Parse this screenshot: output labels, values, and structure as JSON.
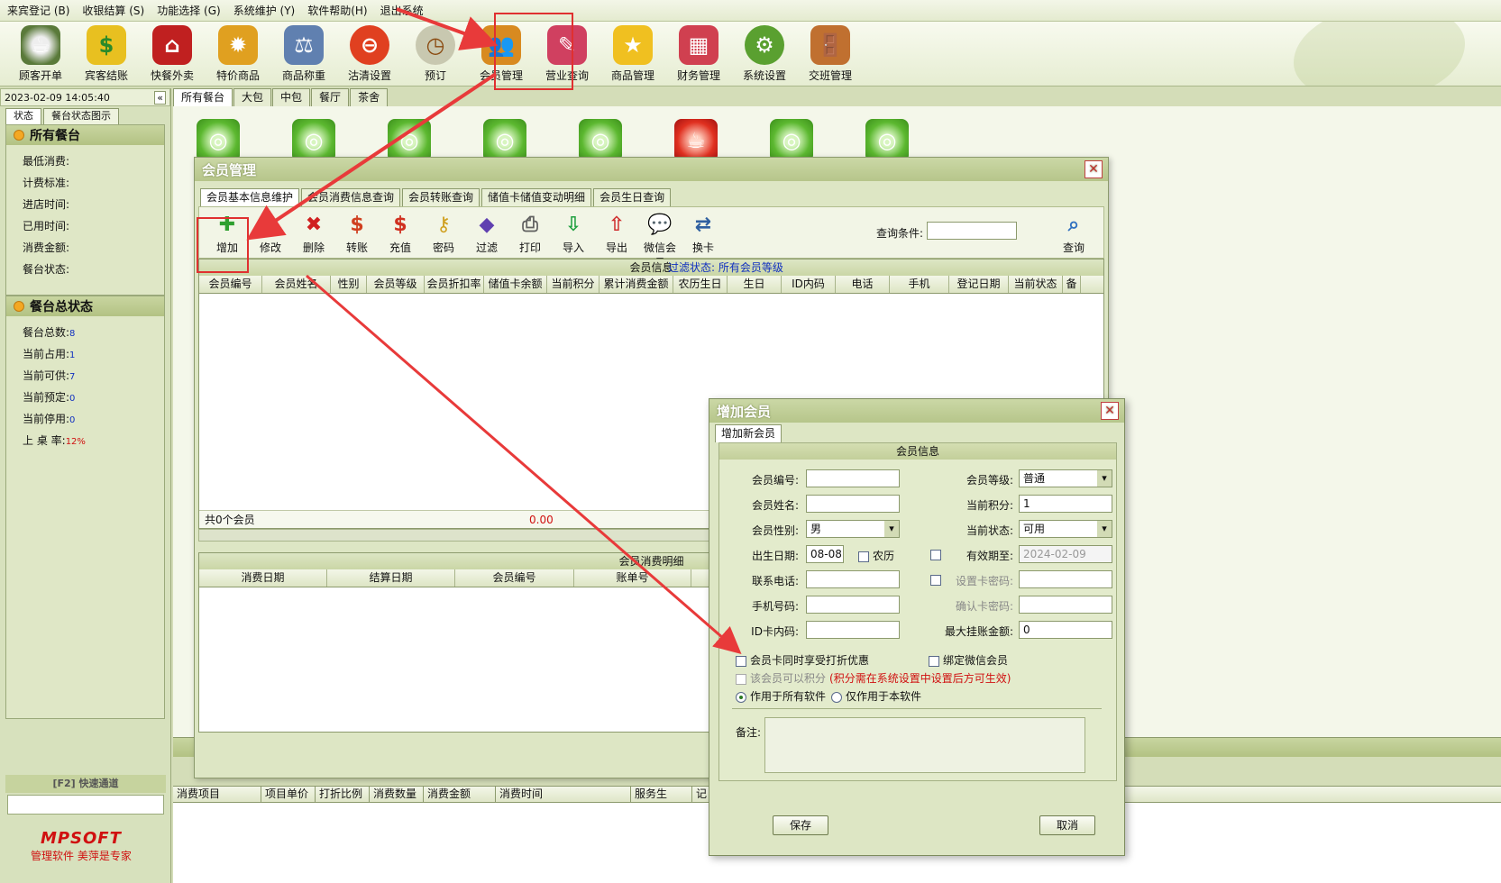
{
  "menu": [
    "来宾登记 (B)",
    "收银结算 (S)",
    "功能选择 (G)",
    "系统维护 (Y)",
    "软件帮助(H)",
    "退出系统"
  ],
  "toolbar": [
    {
      "label": "顾客开单",
      "icon": "tea-cup-icon"
    },
    {
      "label": "宾客结账",
      "icon": "money-arrow-icon"
    },
    {
      "label": "快餐外卖",
      "icon": "takeout-icon"
    },
    {
      "label": "特价商品",
      "icon": "gear-star-icon"
    },
    {
      "label": "商品称重",
      "icon": "scale-icon"
    },
    {
      "label": "沽清设置",
      "icon": "no-entry-icon"
    },
    {
      "label": "预订",
      "icon": "clock-icon"
    },
    {
      "label": "会员管理",
      "icon": "members-icon"
    },
    {
      "label": "营业查询",
      "icon": "eraser-icon"
    },
    {
      "label": "商品管理",
      "icon": "star-icon"
    },
    {
      "label": "财务管理",
      "icon": "calculator-icon"
    },
    {
      "label": "系统设置",
      "icon": "settings-gear-icon"
    },
    {
      "label": "交班管理",
      "icon": "exit-door-icon"
    }
  ],
  "left": {
    "datetime": "2023-02-09 14:05:40",
    "collapse": "«",
    "tabs": [
      "状态",
      "餐台状态图示"
    ],
    "section1_title": "所有餐台",
    "section1_rows": [
      "最低消费:",
      "计费标准:",
      "进店时间:",
      "已用时间:",
      "消费金额:",
      "餐台状态:"
    ],
    "section2_title": "餐台总状态",
    "section2_rows": [
      {
        "label": "餐台总数:",
        "value": "8"
      },
      {
        "label": "当前占用:",
        "value": "1"
      },
      {
        "label": "当前可供:",
        "value": "7"
      },
      {
        "label": "当前预定:",
        "value": "0"
      },
      {
        "label": "当前停用:",
        "value": "0"
      },
      {
        "label": "上 桌 率:",
        "value": "12%"
      }
    ],
    "quick_channel": "[F2] 快速通道",
    "logo": "MPSOFT",
    "slogan": "管理软件 美萍是专家"
  },
  "main_tabs": [
    "所有餐台",
    "大包",
    "中包",
    "餐厅",
    "茶舍"
  ],
  "bottom_grid_headers": [
    "消费项目",
    "项目单价",
    "打折比例",
    "消费数量",
    "消费金额",
    "消费时间",
    "服务生",
    "记"
  ],
  "member_window": {
    "title": "会员管理",
    "tabs": [
      "会员基本信息维护",
      "会员消费信息查询",
      "会员转账查询",
      "储值卡储值变动明细",
      "会员生日查询"
    ],
    "tools": [
      {
        "label": "增加",
        "icon": "add-doc-icon",
        "color": "#2fa02f"
      },
      {
        "label": "修改",
        "icon": "edit-icon",
        "color": "#3060c0"
      },
      {
        "label": "删除",
        "icon": "delete-icon",
        "color": "#d02020"
      },
      {
        "label": "转账",
        "icon": "transfer-icon",
        "color": "#d04020"
      },
      {
        "label": "充值",
        "icon": "recharge-icon",
        "color": "#d03020"
      },
      {
        "label": "密码",
        "icon": "key-icon",
        "color": "#d0a020"
      },
      {
        "label": "过滤",
        "icon": "filter-icon",
        "color": "#6040b0"
      },
      {
        "label": "打印",
        "icon": "printer-icon",
        "color": "#606060"
      },
      {
        "label": "导入",
        "icon": "import-icon",
        "color": "#20a040"
      },
      {
        "label": "导出",
        "icon": "export-icon",
        "color": "#d03030"
      },
      {
        "label": "微信会员",
        "icon": "wechat-icon",
        "color": "#3070c0"
      },
      {
        "label": "换卡",
        "icon": "swap-card-icon",
        "color": "#3060a0"
      }
    ],
    "query_label": "查询条件:",
    "query_button": "查询",
    "grid_caption": "会员信息",
    "filter_status": "过滤状态: 所有会员等级",
    "headers": [
      "会员编号",
      "会员姓名",
      "性别",
      "会员等级",
      "会员折扣率",
      "储值卡余额",
      "当前积分",
      "累计消费金额",
      "农历生日",
      "生日",
      "ID内码",
      "电话",
      "手机",
      "登记日期",
      "当前状态",
      "备"
    ],
    "summary_count": "共0个会员",
    "summary_amount": "0.00",
    "detail_caption": "会员消费明细",
    "detail_headers": [
      "消费日期",
      "结算日期",
      "会员编号",
      "账单号"
    ]
  },
  "add_dialog": {
    "title": "增加会员",
    "tab": "增加新会员",
    "caption": "会员信息",
    "fields": {
      "member_no_label": "会员编号:",
      "member_no": "",
      "name_label": "会员姓名:",
      "name": "",
      "gender_label": "会员性别:",
      "gender": "男",
      "birth_label": "出生日期:",
      "birth": "08-08",
      "lunar_label": "农历",
      "phone_label": "联系电话:",
      "phone": "",
      "mobile_label": "手机号码:",
      "mobile": "",
      "idcard_label": "ID卡内码:",
      "idcard": "",
      "level_label": "会员等级:",
      "level": "普通",
      "points_label": "当前积分:",
      "points": "1",
      "status_label": "当前状态:",
      "status": "可用",
      "expire_label": "有效期至:",
      "expire": "2024-02-09",
      "cardpwd_label": "设置卡密码:",
      "cardpwd": "",
      "confirmpwd_label": "确认卡密码:",
      "confirmpwd": "",
      "credit_label": "最大挂账金额:",
      "credit": "0"
    },
    "opt_discount": "会员卡同时享受打折优惠",
    "opt_wechat": "绑定微信会员",
    "opt_points": "该会员可以积分",
    "opt_points_note": "(积分需在系统设置中设置后方可生效)",
    "radio_all": "作用于所有软件",
    "radio_this": "仅作用于本软件",
    "remark_label": "备注:",
    "save": "保存",
    "cancel": "取消"
  }
}
